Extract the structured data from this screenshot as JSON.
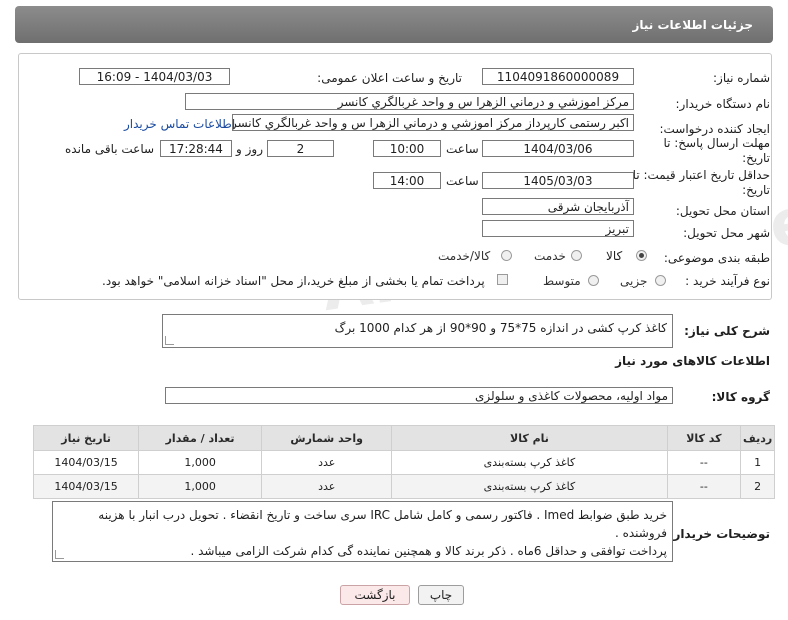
{
  "header": {
    "title": "جزئیات اطلاعات نیاز"
  },
  "form": {
    "need_number_label": "شماره نیاز:",
    "need_number": "1104091860000089",
    "announce_label": "تاریخ و ساعت اعلان عمومی:",
    "announce_value": "1404/03/03 - 16:09",
    "buyer_org_label": "نام دستگاه خریدار:",
    "buyer_org": "مرکز اموزشي و درماني الزهرا س  و واحد غربالگري کانسر",
    "creator_label": "ایجاد کننده درخواست:",
    "creator": "اکبر رستمی کارپرداز مرکز اموزشي و درماني الزهرا س  و واحد غربالگري کانسر",
    "contact_link": "اطلاعات تماس خریدار",
    "deadline_label": "مهلت ارسال پاسخ: تا تاریخ:",
    "deadline_date": "1404/03/06",
    "time_label": "ساعت",
    "deadline_time": "10:00",
    "days_value": "2",
    "days_label": "روز و",
    "remaining_time": "17:28:44",
    "remaining_label": "ساعت باقی مانده",
    "validity_label": "حداقل تاریخ اعتبار قیمت: تا تاریخ:",
    "validity_date": "1405/03/03",
    "validity_time": "14:00",
    "province_label": "استان محل تحویل:",
    "province": "آذربایجان شرقی",
    "city_label": "شهر محل تحویل:",
    "city": "تبریز",
    "category_label": "طبقه بندی موضوعی:",
    "category_options": [
      "کالا",
      "خدمت",
      "کالا/خدمت"
    ],
    "category_selected": "کالا",
    "process_label": "نوع فرآیند خرید :",
    "process_options": [
      "جزیی",
      "متوسط"
    ],
    "payment_note": "پرداخت تمام یا بخشی از مبلغ خرید،از محل \"اسناد خزانه اسلامی\" خواهد بود."
  },
  "summary": {
    "label": "شرح کلی نیاز:",
    "text": "کاغذ کرپ کشی در اندازه 75*75  و 90*90 از هر کدام 1000 برگ"
  },
  "goods": {
    "section_title": "اطلاعات کالاهای مورد نیاز",
    "group_label": "گروه کالا:",
    "group_value": "مواد اولیه، محصولات کاغذی و سلولزی",
    "columns": [
      "ردیف",
      "کد کالا",
      "نام کالا",
      "واحد شمارش",
      "تعداد / مقدار",
      "تاریخ نیاز"
    ],
    "rows": [
      {
        "row": "1",
        "code": "--",
        "name": "کاغذ کرپ بسته‌بندی",
        "unit": "عدد",
        "qty": "1,000",
        "date": "1404/03/15"
      },
      {
        "row": "2",
        "code": "--",
        "name": "کاغذ کرپ بسته‌بندی",
        "unit": "عدد",
        "qty": "1,000",
        "date": "1404/03/15"
      }
    ]
  },
  "buyer_notes": {
    "label": "توضیحات خریدار:",
    "line1": "خرید طبق ضوابط Imed . فاکتور رسمی و کامل شامل IRC سری ساخت و تاریخ انقضاء . تحویل درب انبار با هزینه فروشنده .",
    "line2": "پرداخت توافقی و حداقل 6ماه . ذکر برند کالا و همچنین نماینده گی کدام شرکت الزامی میباشد ."
  },
  "buttons": {
    "print": "چاپ",
    "back": "بازگشت"
  },
  "watermark": "AriaTender.neT"
}
